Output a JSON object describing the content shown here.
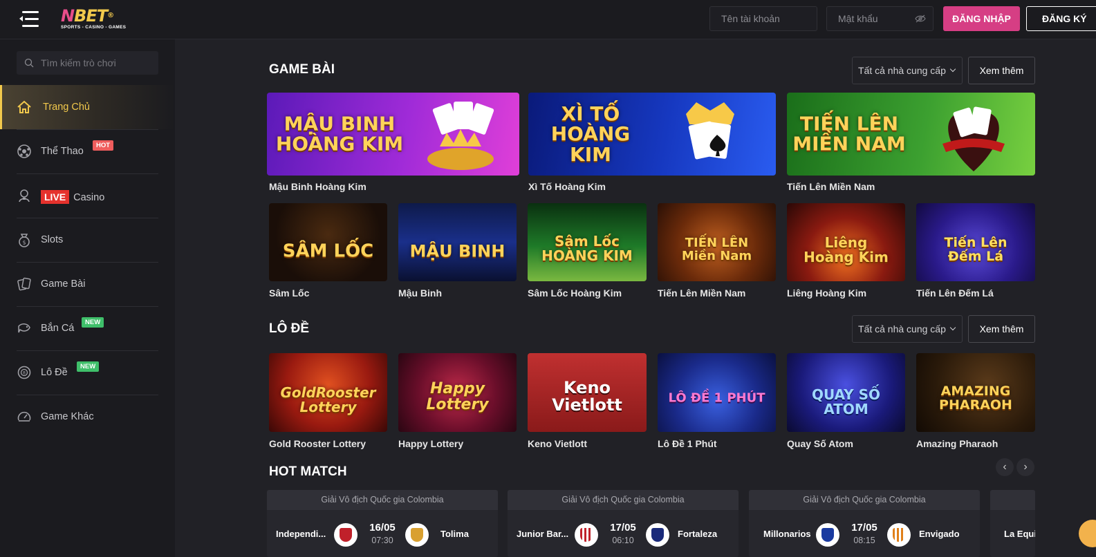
{
  "header": {
    "logo_main": "NBET",
    "logo_sub": "SPORTS - CASINO - GAMES",
    "username_placeholder": "Tên tài khoản",
    "password_placeholder": "Mật khẩu",
    "login_label": "ĐĂNG NHẬP",
    "register_label": "ĐĂNG KÝ"
  },
  "sidebar": {
    "search_placeholder": "Tìm kiếm trò chơi",
    "items": [
      {
        "label": "Trang Chủ",
        "icon": "home-icon"
      },
      {
        "label": "Thể Thao",
        "icon": "soccer-ball-icon",
        "badge": "HOT"
      },
      {
        "label": "Casino",
        "icon": "dealer-icon",
        "live": "LIVE"
      },
      {
        "label": "Slots",
        "icon": "slot-bag-icon"
      },
      {
        "label": "Game Bài",
        "icon": "cards-icon"
      },
      {
        "label": "Bắn Cá",
        "icon": "fish-icon",
        "badge": "NEW"
      },
      {
        "label": "Lô Đề",
        "icon": "lottery-ball-icon",
        "badge": "NEW"
      },
      {
        "label": "Game Khác",
        "icon": "gauge-icon"
      }
    ]
  },
  "sections": {
    "game_bai": {
      "title": "GAME BÀI",
      "provider": "Tất cả nhà cung cấp",
      "more": "Xem thêm",
      "featured": [
        {
          "label": "Mậu Binh Hoàng Kim",
          "art": "MẬU BINH\nHOÀNG KIM"
        },
        {
          "label": "Xì Tố Hoàng Kim",
          "art": "XÌ TỐ\nHOÀNG KIM"
        },
        {
          "label": "Tiến Lên Miền Nam",
          "art": "TIẾN LÊN\nMIỀN NAM"
        }
      ],
      "games": [
        {
          "label": "Sâm Lốc",
          "art": "SÂM LỐC"
        },
        {
          "label": "Mậu Binh",
          "art": "MẬU BINH"
        },
        {
          "label": "Sâm Lốc Hoàng Kim",
          "art": "Sâm Lốc\nHOÀNG KIM"
        },
        {
          "label": "Tiến Lên Miền Nam",
          "art": "TIẾN LÊN\nMiền Nam"
        },
        {
          "label": "Liêng Hoàng Kim",
          "art": "Liêng\nHoàng Kim"
        },
        {
          "label": "Tiến Lên Đếm Lá",
          "art": "Tiến Lên\nĐếm Lá"
        }
      ]
    },
    "lo_de": {
      "title": "LÔ ĐỀ",
      "provider": "Tất cả nhà cung cấp",
      "more": "Xem thêm",
      "games": [
        {
          "label": "Gold Rooster Lottery",
          "art": "GoldRooster\nLottery"
        },
        {
          "label": "Happy Lottery",
          "art": "Happy\nLottery"
        },
        {
          "label": "Keno Vietlott",
          "art": "Keno\nVietlott"
        },
        {
          "label": "Lô Đề 1 Phút",
          "art": "LÔ ĐỀ 1 PHÚT"
        },
        {
          "label": "Quay Số Atom",
          "art": "QUAY SỐ\nATOM"
        },
        {
          "label": "Amazing Pharaoh",
          "art": "AMAZING\nPHARAOH"
        }
      ]
    },
    "hot_match": {
      "title": "HOT MATCH",
      "prev": "‹",
      "next": "›",
      "matches": [
        {
          "league": "Giải Vô địch Quốc gia Colombia",
          "home": "Independi...",
          "away": "Tolima",
          "date": "16/05",
          "time": "07:30"
        },
        {
          "league": "Giải Vô địch Quốc gia Colombia",
          "home": "Junior Bar...",
          "away": "Fortaleza",
          "date": "17/05",
          "time": "06:10"
        },
        {
          "league": "Giải Vô địch Quốc gia Colombia",
          "home": "Millonarios",
          "away": "Envigado",
          "date": "17/05",
          "time": "08:15"
        },
        {
          "league": "",
          "home": "La Equi",
          "away": "",
          "date": "",
          "time": ""
        }
      ]
    }
  },
  "colors": {
    "accent_pink": "#d63e84",
    "accent_gold": "#f2c94c",
    "bg": "#212126",
    "sidebar_bg": "#1b1b1f"
  }
}
